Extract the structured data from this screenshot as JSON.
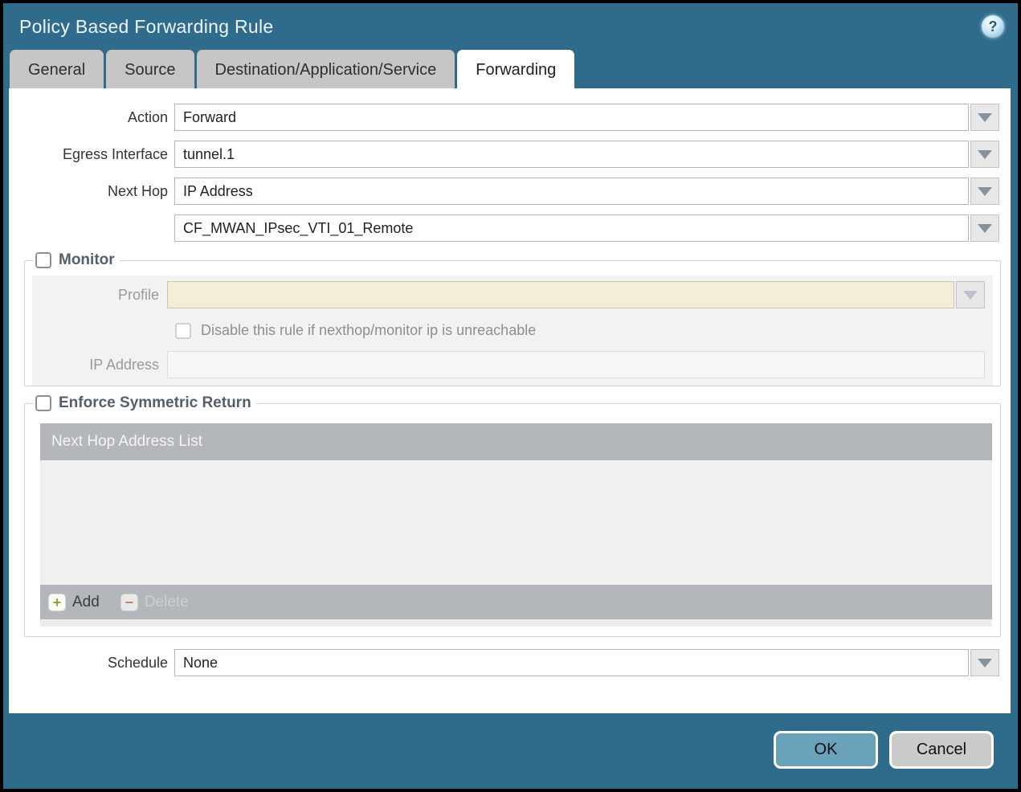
{
  "dialog": {
    "title": "Policy Based Forwarding Rule"
  },
  "icons": {
    "help": "?",
    "add_plus": "+",
    "delete_minus": "−"
  },
  "tabs": [
    {
      "label": "General",
      "active": false
    },
    {
      "label": "Source",
      "active": false
    },
    {
      "label": "Destination/Application/Service",
      "active": false
    },
    {
      "label": "Forwarding",
      "active": true
    }
  ],
  "form": {
    "action": {
      "label": "Action",
      "value": "Forward"
    },
    "egress_interface": {
      "label": "Egress Interface",
      "value": "tunnel.1"
    },
    "next_hop": {
      "label": "Next Hop",
      "value": "IP Address"
    },
    "next_hop_address": {
      "value": "CF_MWAN_IPsec_VTI_01_Remote"
    },
    "schedule": {
      "label": "Schedule",
      "value": "None"
    }
  },
  "monitor": {
    "legend": "Monitor",
    "checked": false,
    "profile": {
      "label": "Profile",
      "value": ""
    },
    "disable_rule": {
      "label": "Disable this rule if nexthop/monitor ip is unreachable",
      "checked": false
    },
    "ip_address": {
      "label": "IP Address",
      "value": ""
    }
  },
  "symmetric_return": {
    "legend": "Enforce Symmetric Return",
    "checked": false,
    "table_header": "Next Hop Address List",
    "rows": [],
    "add_label": "Add",
    "delete_label": "Delete"
  },
  "footer": {
    "ok_label": "OK",
    "cancel_label": "Cancel"
  },
  "colors": {
    "titlebar_teal": "#2f6b8b",
    "tab_inactive": "#c6c6c6",
    "table_gray": "#b3b7bb",
    "profile_disabled_bg": "#f3edda",
    "ok_button": "#6aa2ba",
    "cancel_button": "#cbcbcb"
  }
}
